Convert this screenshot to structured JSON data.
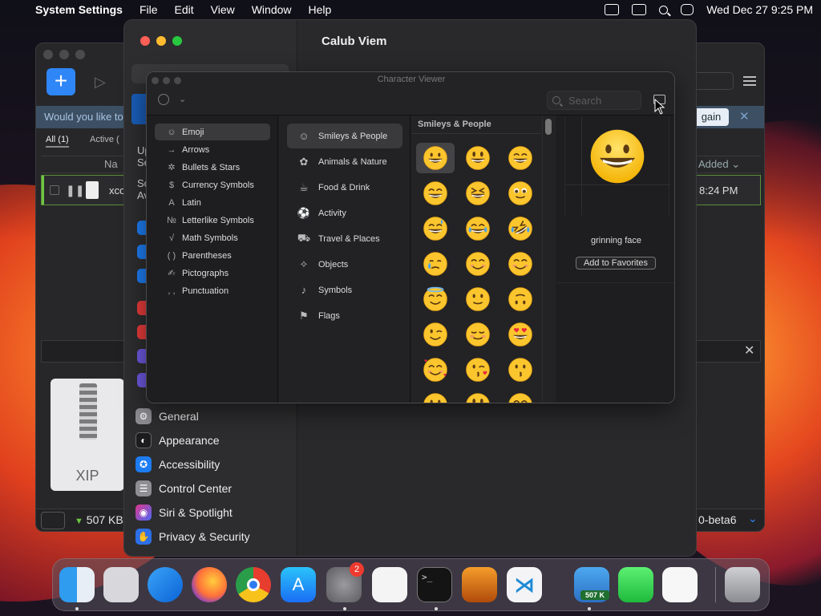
{
  "menubar": {
    "app_name": "System Settings",
    "items": [
      "File",
      "Edit",
      "View",
      "Window",
      "Help"
    ],
    "datetime": "Wed Dec 27  9:25 PM"
  },
  "background_app": {
    "banner_text": "Would you like to",
    "banner_button": "gain",
    "filters": {
      "all": "All (1)",
      "active": "Active ("
    },
    "col_name": "Na",
    "col_added": "Added",
    "row": {
      "name": "xco",
      "time": "8:24 PM"
    },
    "file_type": "XIP",
    "speed": "507 KB",
    "version": "0-beta6"
  },
  "settings": {
    "title": "Calub Viem",
    "sidebar_fragments": {
      "up": "Up",
      "se": "Se",
      "so": "So",
      "av": "Av"
    },
    "sidebar_items": [
      {
        "label": "General",
        "color": "#8e8e93"
      },
      {
        "label": "Appearance",
        "color": "#1c1c1e"
      },
      {
        "label": "Accessibility",
        "color": "#1d7cf2"
      },
      {
        "label": "Control Center",
        "color": "#8e8e93"
      },
      {
        "label": "Siri & Spotlight",
        "color": "#b03bd6"
      },
      {
        "label": "Privacy & Security",
        "color": "#2d6fe8"
      }
    ]
  },
  "character_viewer": {
    "title": "Character Viewer",
    "search_placeholder": "Search",
    "categories": [
      {
        "label": "Emoji",
        "glyph": "☺"
      },
      {
        "label": "Arrows",
        "glyph": "→"
      },
      {
        "label": "Bullets & Stars",
        "glyph": "✲"
      },
      {
        "label": "Currency Symbols",
        "glyph": "$"
      },
      {
        "label": "Latin",
        "glyph": "A"
      },
      {
        "label": "Letterlike Symbols",
        "glyph": "№"
      },
      {
        "label": "Math Symbols",
        "glyph": "√"
      },
      {
        "label": "Parentheses",
        "glyph": "( )"
      },
      {
        "label": "Pictographs",
        "glyph": "✍"
      },
      {
        "label": "Punctuation",
        "glyph": ", ,"
      }
    ],
    "subcategories": [
      {
        "label": "Smileys & People",
        "glyph": "☺"
      },
      {
        "label": "Animals & Nature",
        "glyph": "✿"
      },
      {
        "label": "Food & Drink",
        "glyph": "☕"
      },
      {
        "label": "Activity",
        "glyph": "⚽"
      },
      {
        "label": "Travel & Places",
        "glyph": "⛟"
      },
      {
        "label": "Objects",
        "glyph": "✧"
      },
      {
        "label": "Symbols",
        "glyph": "♪"
      },
      {
        "label": "Flags",
        "glyph": "⚑"
      }
    ],
    "emoji_section_title": "Smileys & People",
    "emoji_grid": [
      "grinning",
      "grinning-big-eyes",
      "grinning-smiling-eyes",
      "beaming",
      "squinting-laugh",
      "face-holding-back-tears",
      "grinning-sweat",
      "tears-of-joy",
      "rolling-laughing",
      "crying",
      "smiling-blush",
      "smiling-eyes",
      "halo",
      "slightly-smiling",
      "upside-down",
      "winking",
      "relieved",
      "heart-eyes",
      "smiling-hearts",
      "kissing-heart",
      "kissing",
      "partial-1",
      "partial-2",
      "partial-3"
    ],
    "selected_name": "grinning face",
    "add_favorites": "Add to Favorites"
  },
  "dock": {
    "apps": [
      {
        "name": "Finder",
        "icon": "finder-icon"
      },
      {
        "name": "Launchpad",
        "icon": "launchpad-icon"
      },
      {
        "name": "Safari",
        "icon": "safari-icon"
      },
      {
        "name": "Firefox",
        "icon": "firefox-icon"
      },
      {
        "name": "Chrome",
        "icon": "chrome-icon"
      },
      {
        "name": "App Store",
        "icon": "app-store-icon"
      },
      {
        "name": "System Settings",
        "icon": "system-settings-icon",
        "badge": "2"
      },
      {
        "name": "TextEdit",
        "icon": "textedit-icon"
      },
      {
        "name": "Terminal",
        "icon": "terminal-icon"
      },
      {
        "name": "GarageBand",
        "icon": "garageband-icon"
      },
      {
        "name": "VS Code",
        "icon": "vscode-icon"
      },
      {
        "name": "Network Monitor",
        "icon": "network-monitor-icon",
        "label": "507 K"
      },
      {
        "name": "Messages",
        "icon": "messages-icon"
      },
      {
        "name": "Freeform",
        "icon": "freeform-icon"
      },
      {
        "name": "Trash",
        "icon": "trash-icon"
      }
    ]
  }
}
